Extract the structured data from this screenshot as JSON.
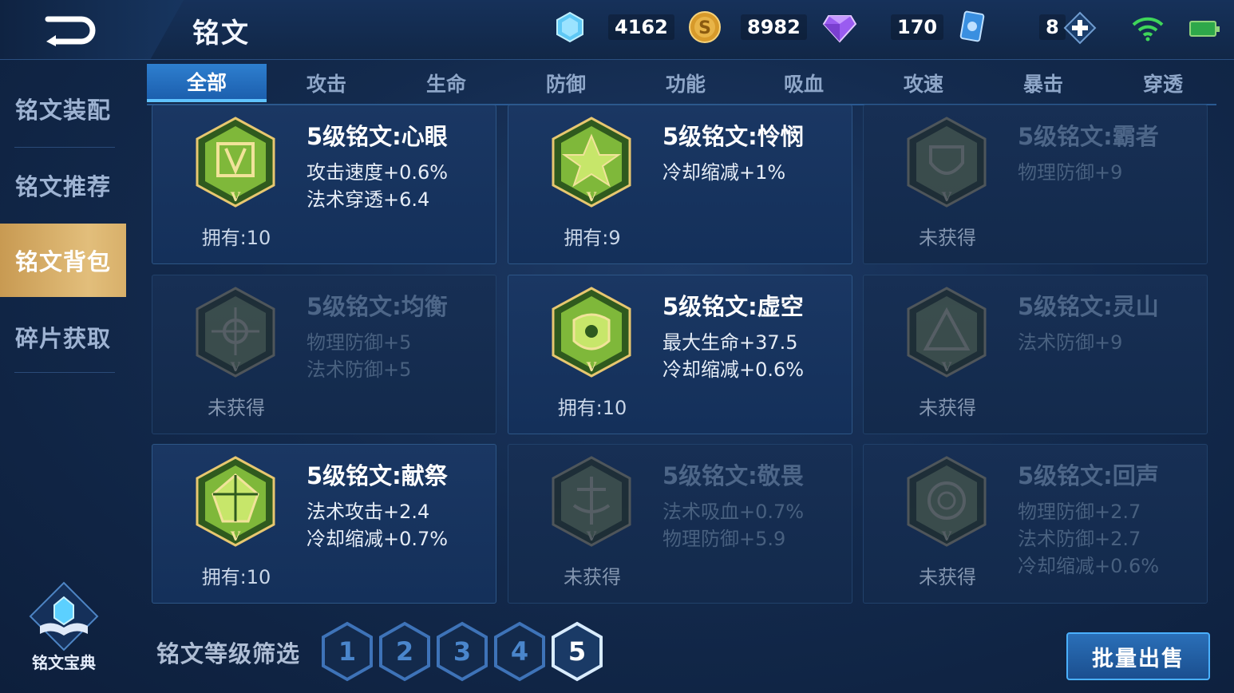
{
  "header": {
    "title": "铭文",
    "resources": [
      {
        "name": "diamond",
        "value": "4162",
        "icon": "crystal-icon"
      },
      {
        "name": "gold",
        "value": "8982",
        "icon": "gold-coin-icon"
      },
      {
        "name": "gem",
        "value": "170",
        "icon": "purple-gem-icon"
      },
      {
        "name": "card",
        "value": "8",
        "icon": "card-icon"
      }
    ]
  },
  "sidebar": {
    "items": [
      {
        "label": "铭文装配"
      },
      {
        "label": "铭文推荐"
      },
      {
        "label": "铭文背包"
      },
      {
        "label": "碎片获取"
      }
    ],
    "active_index": 2,
    "codex_label": "铭文宝典"
  },
  "tabs": [
    "全部",
    "攻击",
    "生命",
    "防御",
    "功能",
    "吸血",
    "攻速",
    "暴击",
    "穿透"
  ],
  "active_tab": 0,
  "runes": [
    {
      "name": "5级铭文:心眼",
      "stats": [
        "攻击速度+0.6%",
        "法术穿透+6.4"
      ],
      "owned": "拥有:10",
      "locked": false,
      "color": "#8cc63f"
    },
    {
      "name": "5级铭文:怜悯",
      "stats": [
        "冷却缩减+1%"
      ],
      "owned": "拥有:9",
      "locked": false,
      "color": "#8cc63f"
    },
    {
      "name": "5级铭文:霸者",
      "stats": [
        "物理防御+9"
      ],
      "owned": "未获得",
      "locked": true,
      "color": "#4f8a52"
    },
    {
      "name": "5级铭文:均衡",
      "stats": [
        "物理防御+5",
        "法术防御+5"
      ],
      "owned": "未获得",
      "locked": true,
      "color": "#4f8a52"
    },
    {
      "name": "5级铭文:虚空",
      "stats": [
        "最大生命+37.5",
        "冷却缩减+0.6%"
      ],
      "owned": "拥有:10",
      "locked": false,
      "color": "#8cc63f"
    },
    {
      "name": "5级铭文:灵山",
      "stats": [
        "法术防御+9"
      ],
      "owned": "未获得",
      "locked": true,
      "color": "#4f8a52"
    },
    {
      "name": "5级铭文:献祭",
      "stats": [
        "法术攻击+2.4",
        "冷却缩减+0.7%"
      ],
      "owned": "拥有:10",
      "locked": false,
      "color": "#8cc63f"
    },
    {
      "name": "5级铭文:敬畏",
      "stats": [
        "法术吸血+0.7%",
        "物理防御+5.9"
      ],
      "owned": "未获得",
      "locked": true,
      "color": "#4f8a52"
    },
    {
      "name": "5级铭文:回声",
      "stats": [
        "物理防御+2.7",
        "法术防御+2.7",
        "冷却缩减+0.6%"
      ],
      "owned": "未获得",
      "locked": true,
      "color": "#4f8a52"
    }
  ],
  "filter": {
    "label": "铭文等级筛选",
    "levels": [
      "1",
      "2",
      "3",
      "4",
      "5"
    ],
    "selected": "5"
  },
  "actions": {
    "bulk_sell": "批量出售"
  },
  "colors": {
    "accent_gold": "#d8b06a",
    "tab_active": "#2e7fcf",
    "level_outline": "#3e73b8"
  }
}
